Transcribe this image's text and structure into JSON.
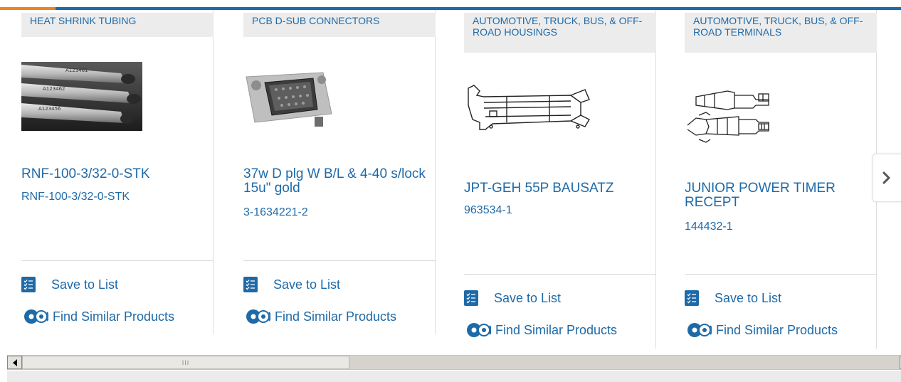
{
  "colors": {
    "accent": "#1e6aa8",
    "highlight": "#f0821e",
    "category_bg": "#ececec"
  },
  "products": [
    {
      "category": "HEAT SHRINK TUBING",
      "title": "RNF-100-3/32-0-STK",
      "part_number": "RNF-100-3/32-0-STK",
      "save_label": "Save to List",
      "similar_label": "Find Similar Products",
      "image": "heat-shrink-tubing-photo"
    },
    {
      "category": "PCB D-SUB CONNECTORS",
      "title": "37w D plg W B/L & 4-40 s/lock 15u\" gold",
      "part_number": "3-1634221-2",
      "save_label": "Save to List",
      "similar_label": "Find Similar Products",
      "image": "dsub-connector-photo"
    },
    {
      "category": "AUTOMOTIVE, TRUCK, BUS, & OFF-ROAD HOUSINGS",
      "title": "JPT-GEH 55P BAUSATZ",
      "part_number": "963534-1",
      "save_label": "Save to List",
      "similar_label": "Find Similar Products",
      "image": "housing-line-drawing"
    },
    {
      "category": "AUTOMOTIVE, TRUCK, BUS, & OFF-ROAD TERMINALS",
      "title": "JUNIOR POWER TIMER RECEPT",
      "part_number": "144432-1",
      "save_label": "Save to List",
      "similar_label": "Find Similar Products",
      "image": "terminal-line-drawing"
    }
  ],
  "carousel": {
    "next_icon": "chevron-right-icon"
  },
  "scrollbar": {
    "left_icon": "arrow-left-icon",
    "thumb_grip": "III"
  },
  "icons": {
    "save": "checklist-icon",
    "similar": "gears-icon"
  }
}
